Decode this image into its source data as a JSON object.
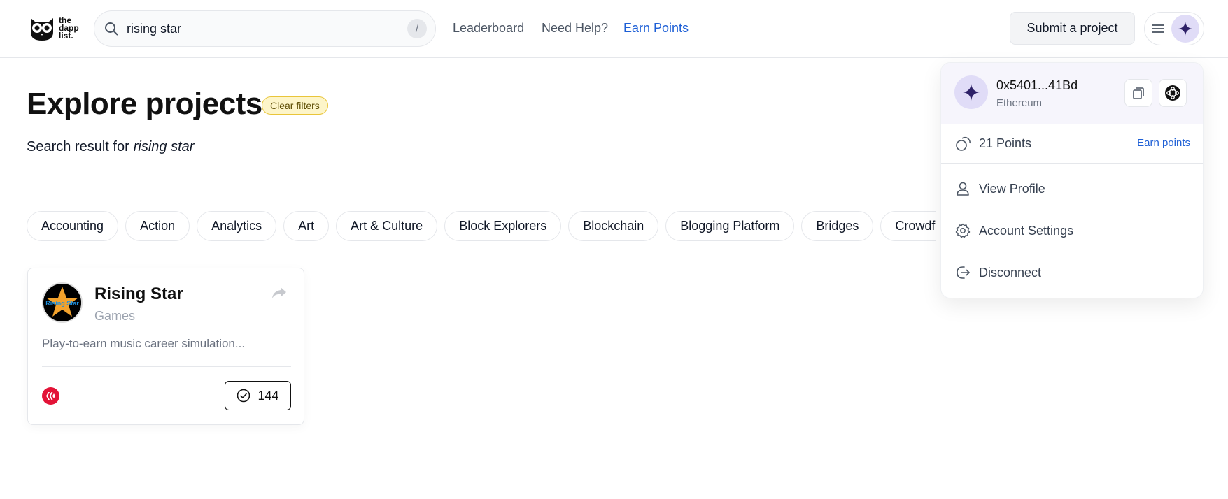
{
  "header": {
    "logo_text": [
      "the",
      "dapp",
      "list."
    ],
    "search": {
      "value": "rising star",
      "shortcut": "/"
    },
    "nav": {
      "leaderboard": "Leaderboard",
      "help": "Need Help?",
      "earn": "Earn Points"
    },
    "submit_label": "Submit a project"
  },
  "main": {
    "title": "Explore projects",
    "clear_filters": "Clear filters",
    "search_result_prefix": "Search result for",
    "search_term": "rising star",
    "categories": [
      "Accounting",
      "Action",
      "Analytics",
      "Art",
      "Art & Culture",
      "Block Explorers",
      "Blockchain",
      "Blogging Platform",
      "Bridges",
      "Crowdfunding"
    ]
  },
  "card": {
    "logo_text": "Rising Star",
    "title": "Rising Star",
    "category": "Games",
    "description": "Play-to-earn music career simulation...",
    "votes": "144"
  },
  "account_menu": {
    "address": "0x5401...41Bd",
    "network": "Ethereum",
    "points": "21 Points",
    "earn_link": "Earn points",
    "items": {
      "profile": "View Profile",
      "settings": "Account Settings",
      "disconnect": "Disconnect"
    }
  },
  "colors": {
    "accent": "#1d5fd6",
    "avatar_bg": "#e0dcf7",
    "avatar_star": "#2e2168",
    "hive_red": "#e31337",
    "filter_badge": "#fdf5c9"
  }
}
